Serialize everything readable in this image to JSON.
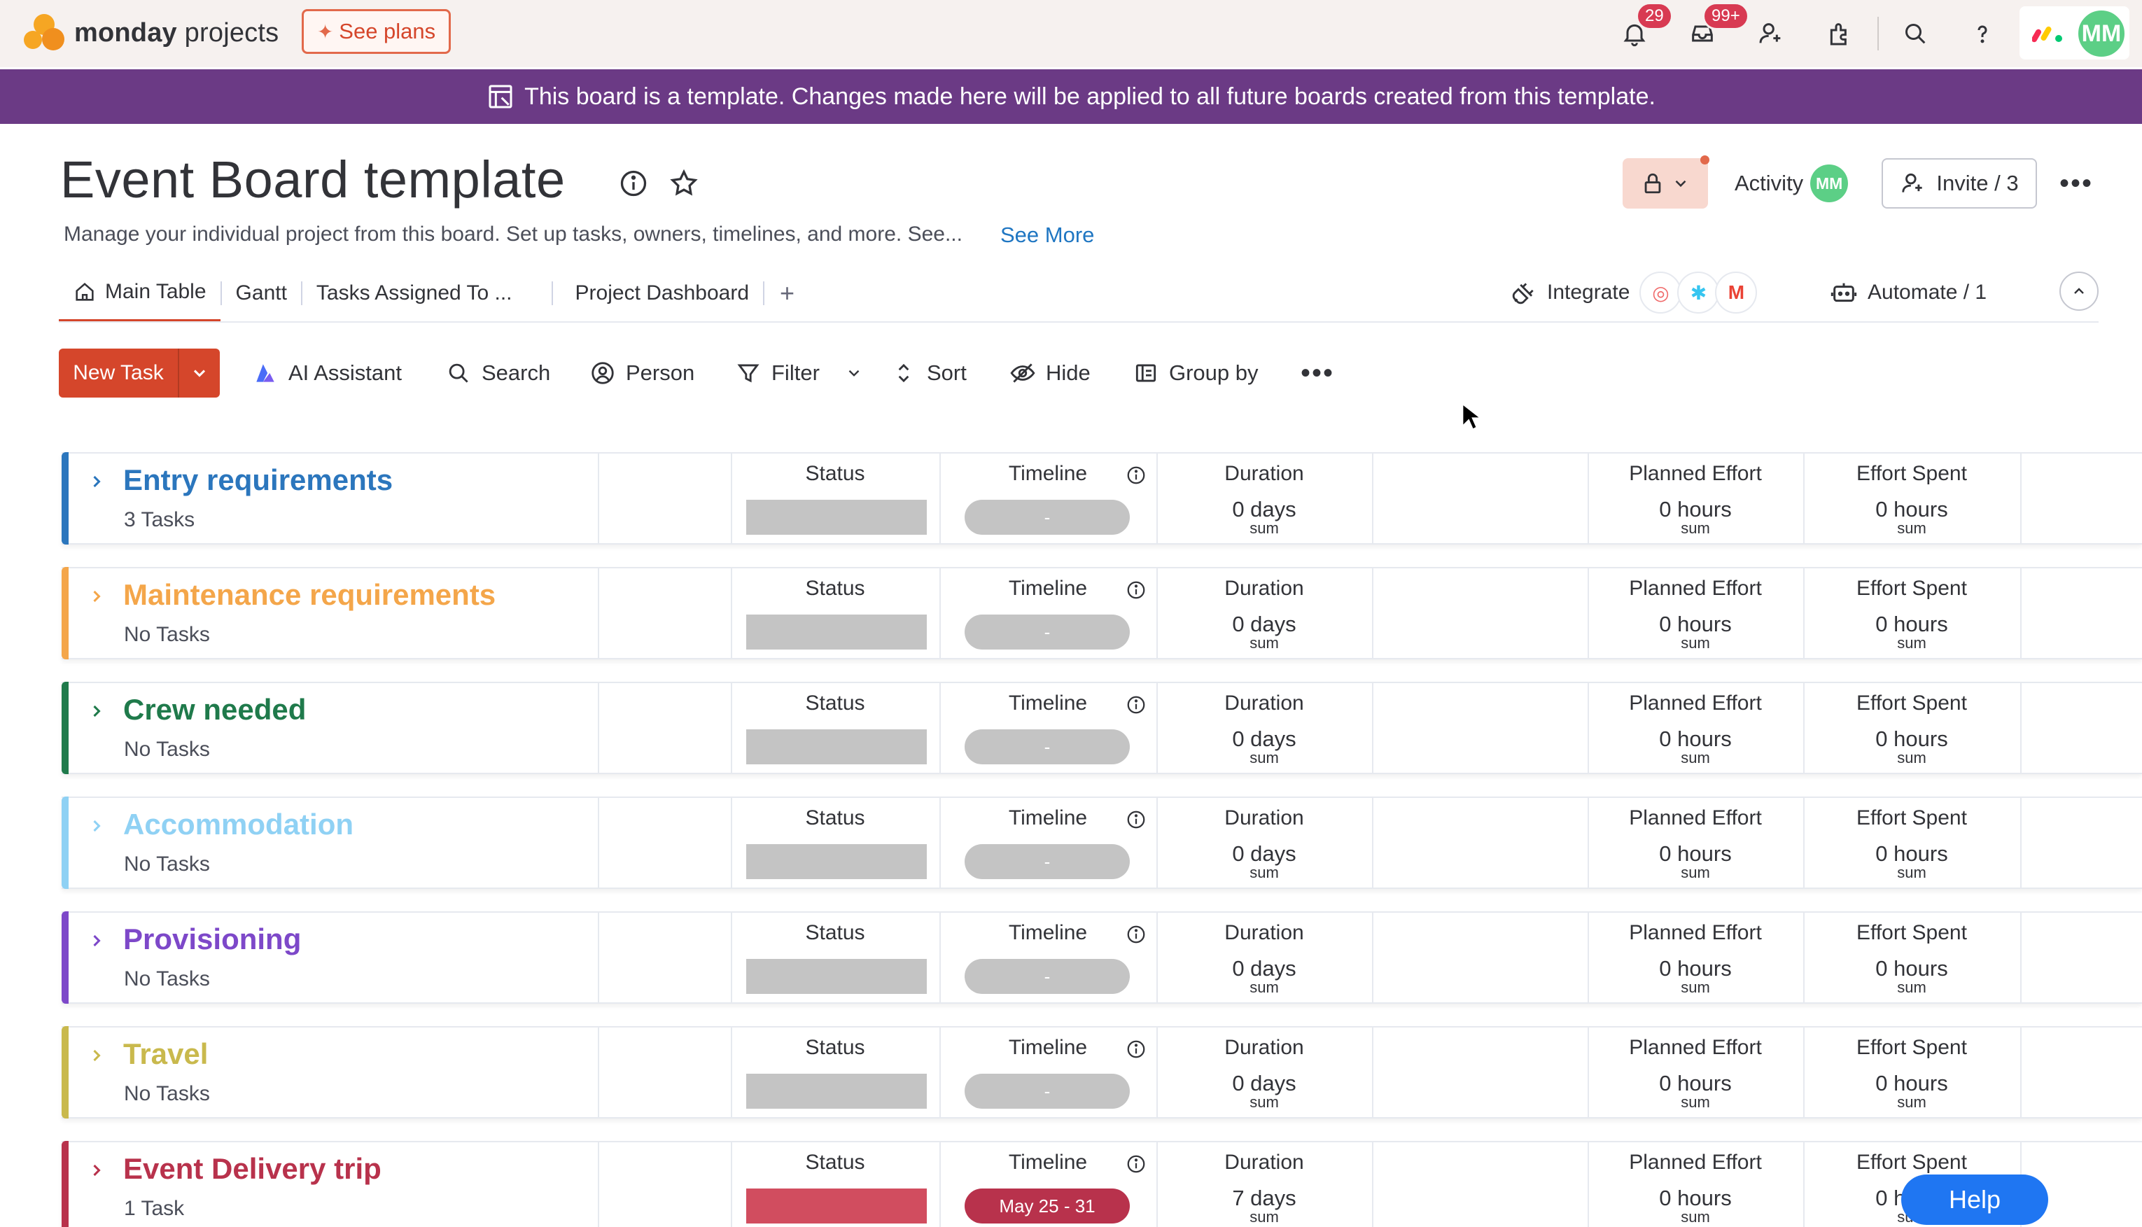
{
  "app": {
    "logo_bold": "monday",
    "logo_rest": "projects",
    "see_plans": "See plans",
    "notifications_count": "29",
    "inbox_count": "99+",
    "user_initials": "MM",
    "icons": [
      "bell-icon",
      "inbox-icon",
      "invite-member-icon",
      "apps-icon",
      "search-icon",
      "help-icon"
    ]
  },
  "banner": {
    "text": "This board is a template. Changes made here will be applied to all future boards created from this template."
  },
  "board": {
    "title": "Event Board template",
    "description": "Manage your individual project from this board. Set up tasks, owners, timelines, and more. See...",
    "see_more": "See More",
    "activity_label": "Activity",
    "activity_initials": "MM",
    "invite_label": "Invite / 3"
  },
  "views": {
    "tabs": [
      {
        "label": "Main Table"
      },
      {
        "label": "Gantt"
      },
      {
        "label": "Tasks Assigned To ..."
      },
      {
        "label": "Project Dashboard"
      }
    ],
    "add": "+",
    "integrate_label": "Integrate",
    "automate_label": "Automate / 1"
  },
  "toolbar": {
    "new_task": "New Task",
    "ai_assistant": "AI Assistant",
    "search": "Search",
    "person": "Person",
    "filter": "Filter",
    "sort": "Sort",
    "hide": "Hide",
    "group_by": "Group by"
  },
  "columns": {
    "status": "Status",
    "timeline": "Timeline",
    "duration": "Duration",
    "planned_effort": "Planned Effort",
    "effort_spent": "Effort Spent",
    "sum_label": "sum"
  },
  "groups": [
    {
      "name": "Entry requirements",
      "count": "3 Tasks",
      "color": "#2b76bd",
      "timeline": "-",
      "duration": "0 days",
      "planned": "0 hours",
      "spent": "0 hours",
      "status_color": "#c4c4c4",
      "timeline_color": "#c4c4c4"
    },
    {
      "name": "Maintenance requirements",
      "count": "No Tasks",
      "color": "#f4a64a",
      "timeline": "-",
      "duration": "0 days",
      "planned": "0 hours",
      "spent": "0 hours",
      "status_color": "#c4c4c4",
      "timeline_color": "#c4c4c4"
    },
    {
      "name": "Crew needed",
      "count": "No Tasks",
      "color": "#1f7a4b",
      "timeline": "-",
      "duration": "0 days",
      "planned": "0 hours",
      "spent": "0 hours",
      "status_color": "#c4c4c4",
      "timeline_color": "#c4c4c4"
    },
    {
      "name": "Accommodation",
      "count": "No Tasks",
      "color": "#8fd1f4",
      "timeline": "-",
      "duration": "0 days",
      "planned": "0 hours",
      "spent": "0 hours",
      "status_color": "#c4c4c4",
      "timeline_color": "#c4c4c4"
    },
    {
      "name": "Provisioning",
      "count": "No Tasks",
      "color": "#7d48c9",
      "timeline": "-",
      "duration": "0 days",
      "planned": "0 hours",
      "spent": "0 hours",
      "status_color": "#c4c4c4",
      "timeline_color": "#c4c4c4"
    },
    {
      "name": "Travel",
      "count": "No Tasks",
      "color": "#c9b94d",
      "timeline": "-",
      "duration": "0 days",
      "planned": "0 hours",
      "spent": "0 hours",
      "status_color": "#c4c4c4",
      "timeline_color": "#c4c4c4"
    },
    {
      "name": "Event Delivery trip",
      "count": "1 Task",
      "color": "#b8324c",
      "timeline": "May 25 - 31",
      "duration": "7 days",
      "planned": "0 hours",
      "spent": "0 hours",
      "status_color": "#d14d5f",
      "timeline_color": "#b8324c"
    }
  ],
  "help": {
    "label": "Help"
  }
}
